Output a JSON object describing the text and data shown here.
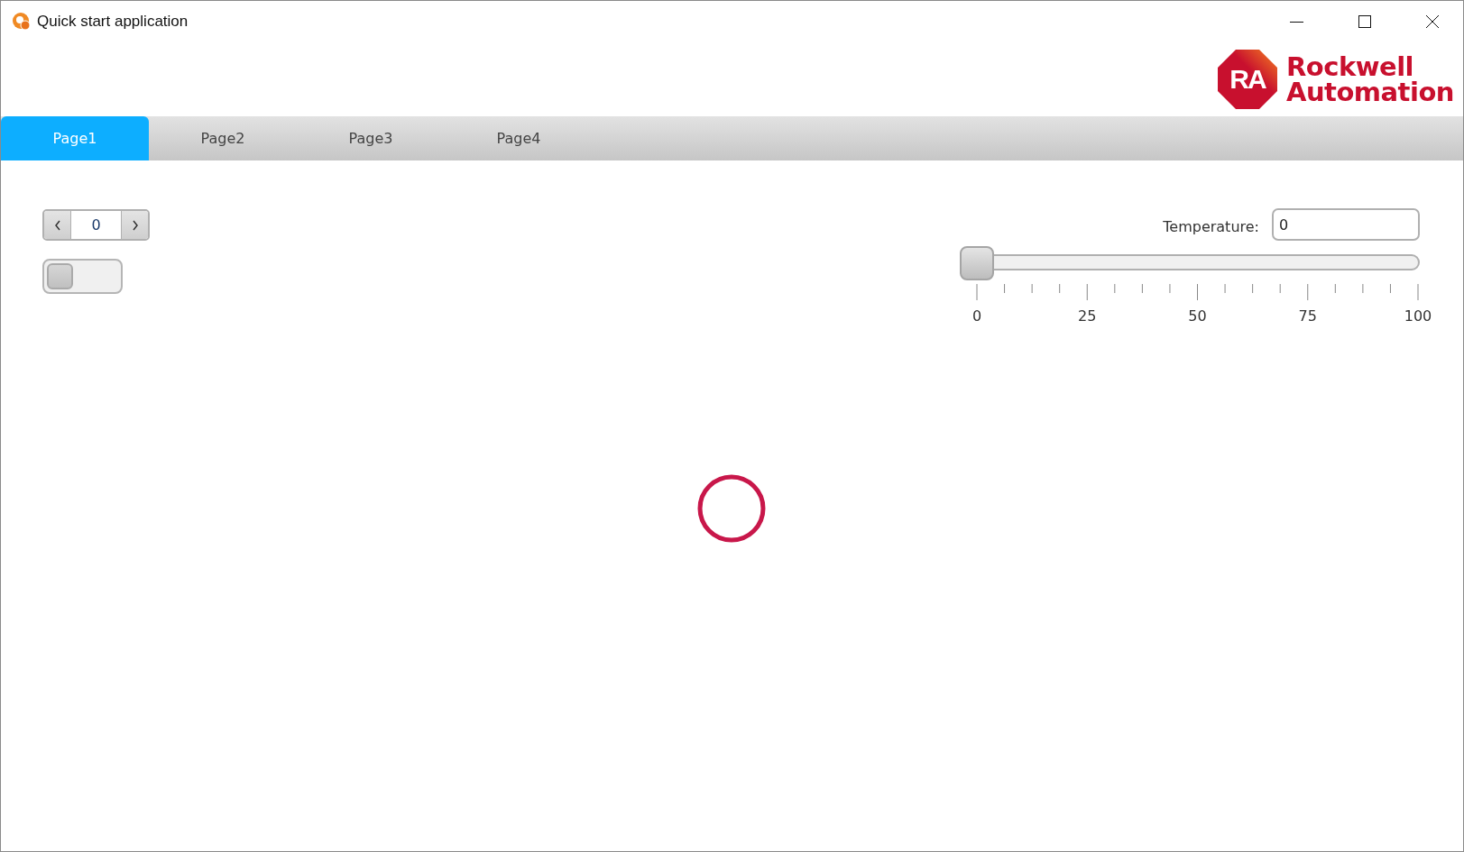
{
  "window": {
    "title": "Quick start application"
  },
  "logo": {
    "initials": "RA",
    "line_1": "Rockwell",
    "line_2": "Automation"
  },
  "tabs": [
    {
      "label": "Page1",
      "selected": true
    },
    {
      "label": "Page2",
      "selected": false
    },
    {
      "label": "Page3",
      "selected": false
    },
    {
      "label": "Page4",
      "selected": false
    }
  ],
  "spinner": {
    "value": "0"
  },
  "toggle": {
    "on": false
  },
  "temperature": {
    "label": "Temperature:",
    "value": "0"
  },
  "slider": {
    "level": 0,
    "tick_labels": [
      "0",
      "25",
      "50",
      "75",
      "100"
    ]
  },
  "indicator": {
    "on": false
  }
}
